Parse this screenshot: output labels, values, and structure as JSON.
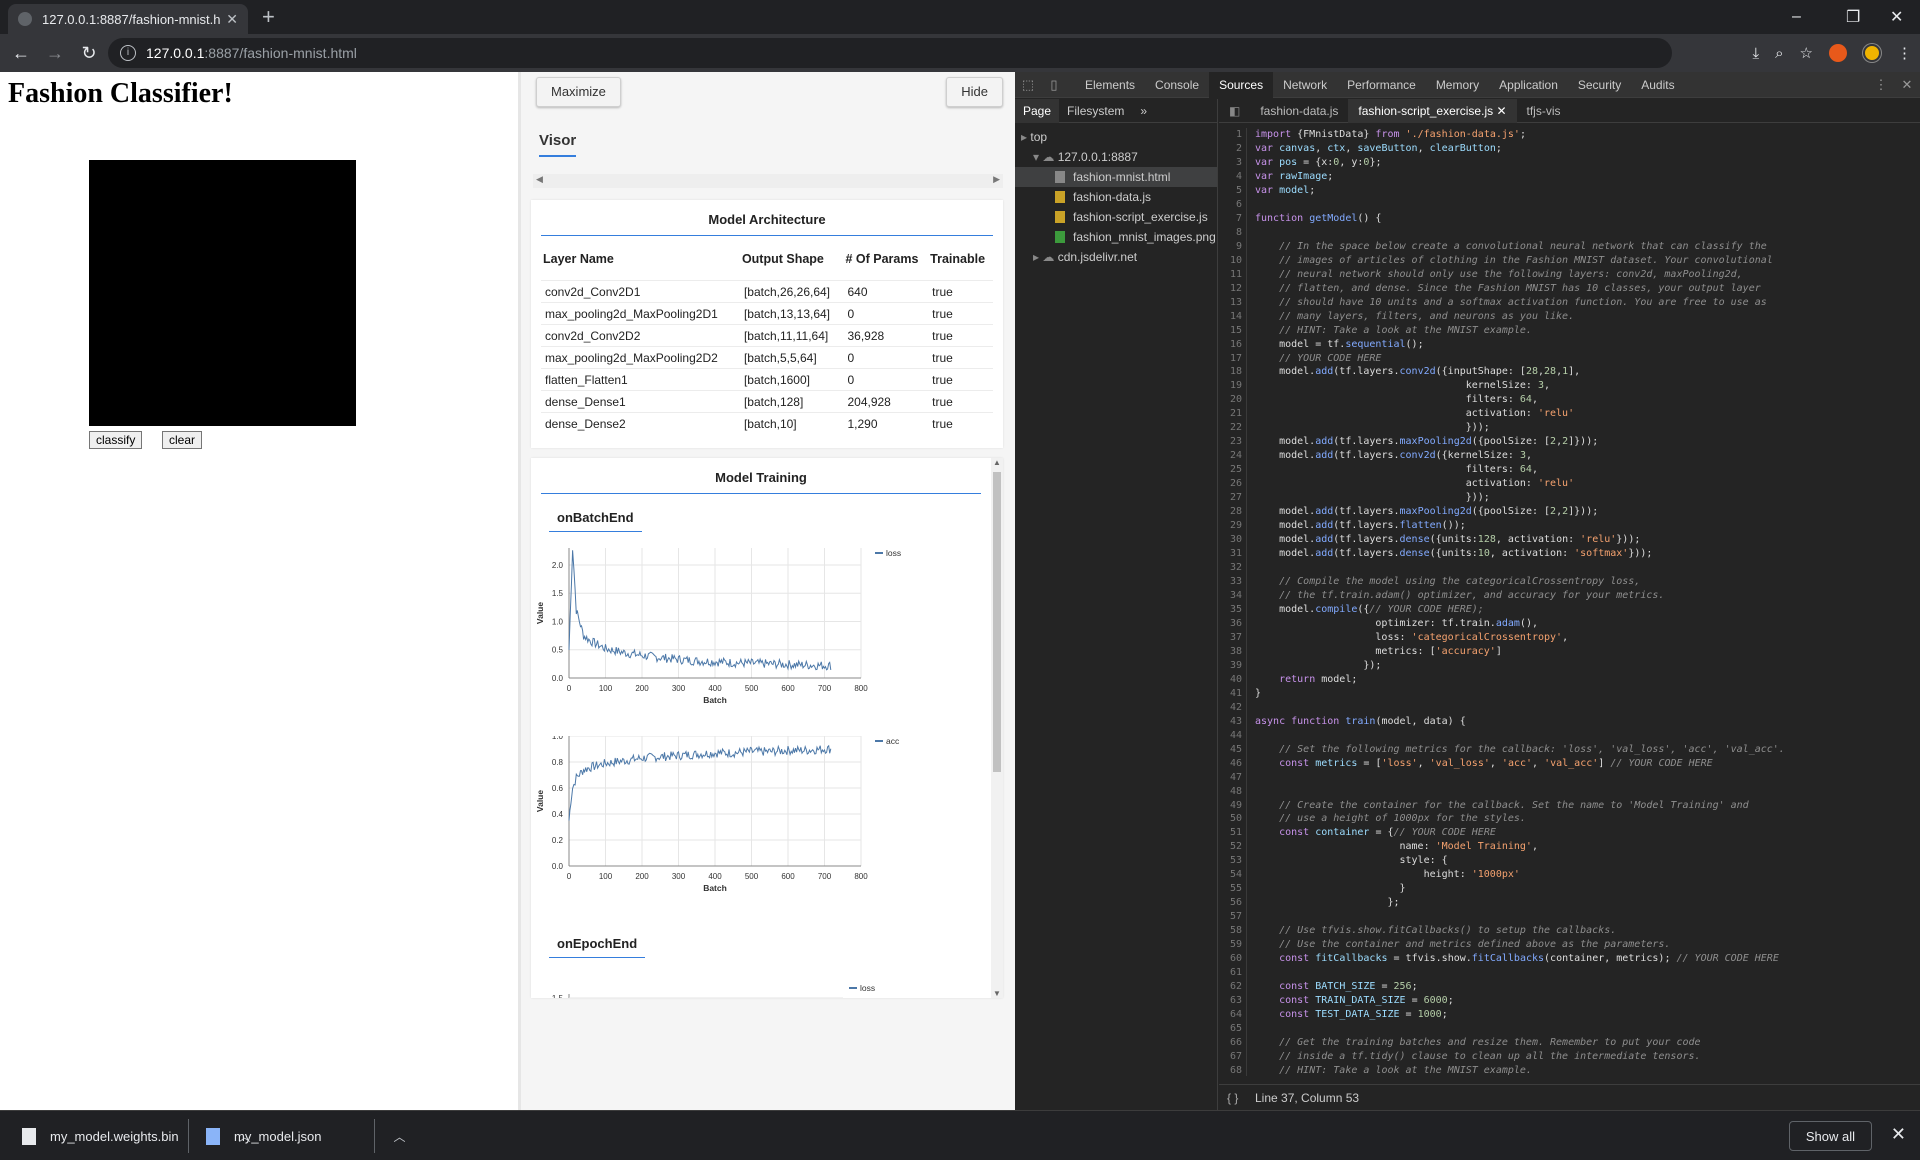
{
  "browser": {
    "tab_title": "127.0.0.1:8887/fashion-mnist.htm",
    "url_host": "127.0.0.1",
    "url_rest": ":8887/fashion-mnist.html"
  },
  "page": {
    "title": "Fashion Classifier!",
    "classify_label": "classify",
    "clear_label": "clear"
  },
  "visor": {
    "maximize_label": "Maximize",
    "hide_label": "Hide",
    "tab_label": "Visor",
    "arch_title": "Model Architecture",
    "arch_headers": [
      "Layer Name",
      "Output Shape",
      "# Of Params",
      "Trainable"
    ],
    "arch_rows": [
      [
        "conv2d_Conv2D1",
        "[batch,26,26,64]",
        "640",
        "true"
      ],
      [
        "max_pooling2d_MaxPooling2D1",
        "[batch,13,13,64]",
        "0",
        "true"
      ],
      [
        "conv2d_Conv2D2",
        "[batch,11,11,64]",
        "36,928",
        "true"
      ],
      [
        "max_pooling2d_MaxPooling2D2",
        "[batch,5,5,64]",
        "0",
        "true"
      ],
      [
        "flatten_Flatten1",
        "[batch,1600]",
        "0",
        "true"
      ],
      [
        "dense_Dense1",
        "[batch,128]",
        "204,928",
        "true"
      ],
      [
        "dense_Dense2",
        "[batch,10]",
        "1,290",
        "true"
      ]
    ],
    "training_title": "Model Training",
    "batch_tab": "onBatchEnd",
    "epoch_tab": "onEpochEnd"
  },
  "chart_data": [
    {
      "type": "line",
      "series": [
        {
          "name": "loss"
        }
      ],
      "xlabel": "Batch",
      "ylabel": "Value",
      "xlim": [
        0,
        800
      ],
      "ylim": [
        0,
        2.3
      ],
      "xticks": [
        0,
        100,
        200,
        300,
        400,
        500,
        600,
        700,
        800
      ],
      "yticks": [
        "0.0",
        "0.5",
        "1.0",
        "1.5",
        "2.0"
      ],
      "xticks_labels": [
        "0",
        "100",
        "200",
        "300",
        "400",
        "500",
        "600",
        "700",
        "800"
      ],
      "x": [
        0,
        10,
        20,
        40,
        60,
        100,
        150,
        200,
        250,
        300,
        350,
        400,
        450,
        500,
        550,
        600,
        650,
        700,
        720
      ],
      "y": [
        0.5,
        2.3,
        1.2,
        0.75,
        0.65,
        0.52,
        0.45,
        0.4,
        0.36,
        0.33,
        0.3,
        0.29,
        0.27,
        0.26,
        0.25,
        0.24,
        0.23,
        0.22,
        0.22
      ]
    },
    {
      "type": "line",
      "series": [
        {
          "name": "acc"
        }
      ],
      "xlabel": "Batch",
      "ylabel": "Value",
      "xlim": [
        0,
        800
      ],
      "ylim": [
        0,
        1.0
      ],
      "xticks": [
        0,
        100,
        200,
        300,
        400,
        500,
        600,
        700,
        800
      ],
      "yticks": [
        "0.0",
        "0.2",
        "0.4",
        "0.6",
        "0.8",
        "1.0"
      ],
      "x": [
        0,
        5,
        10,
        20,
        40,
        60,
        100,
        150,
        200,
        250,
        300,
        350,
        400,
        450,
        500,
        550,
        600,
        650,
        700,
        720
      ],
      "y": [
        0.35,
        0.5,
        0.6,
        0.68,
        0.74,
        0.76,
        0.79,
        0.81,
        0.83,
        0.84,
        0.85,
        0.86,
        0.87,
        0.87,
        0.88,
        0.88,
        0.89,
        0.89,
        0.9,
        0.9
      ]
    },
    {
      "type": "line",
      "series": [
        {
          "name": "loss"
        }
      ],
      "yticks": [
        "1.5"
      ]
    }
  ],
  "devtools": {
    "tabs": [
      "Elements",
      "Console",
      "Sources",
      "Network",
      "Performance",
      "Memory",
      "Application",
      "Security",
      "Audits"
    ],
    "nav_tabs": [
      "Page",
      "Filesystem"
    ],
    "tree": {
      "top": "top",
      "host": "127.0.0.1:8887",
      "files": [
        "fashion-mnist.html",
        "fashion-data.js",
        "fashion-script_exercise.js",
        "fashion_mnist_images.png"
      ],
      "cdn": "cdn.jsdelivr.net"
    },
    "editor_tabs": [
      "fashion-data.js",
      "fashion-script_exercise.js",
      "tfjs-vis"
    ],
    "status": "Line 37, Column 53"
  },
  "downloads": {
    "items": [
      "my_model.weights.bin",
      "my_model.json"
    ],
    "show_all": "Show all"
  },
  "colors": {
    "accent": "#357edd",
    "line": "#4c78a8"
  }
}
